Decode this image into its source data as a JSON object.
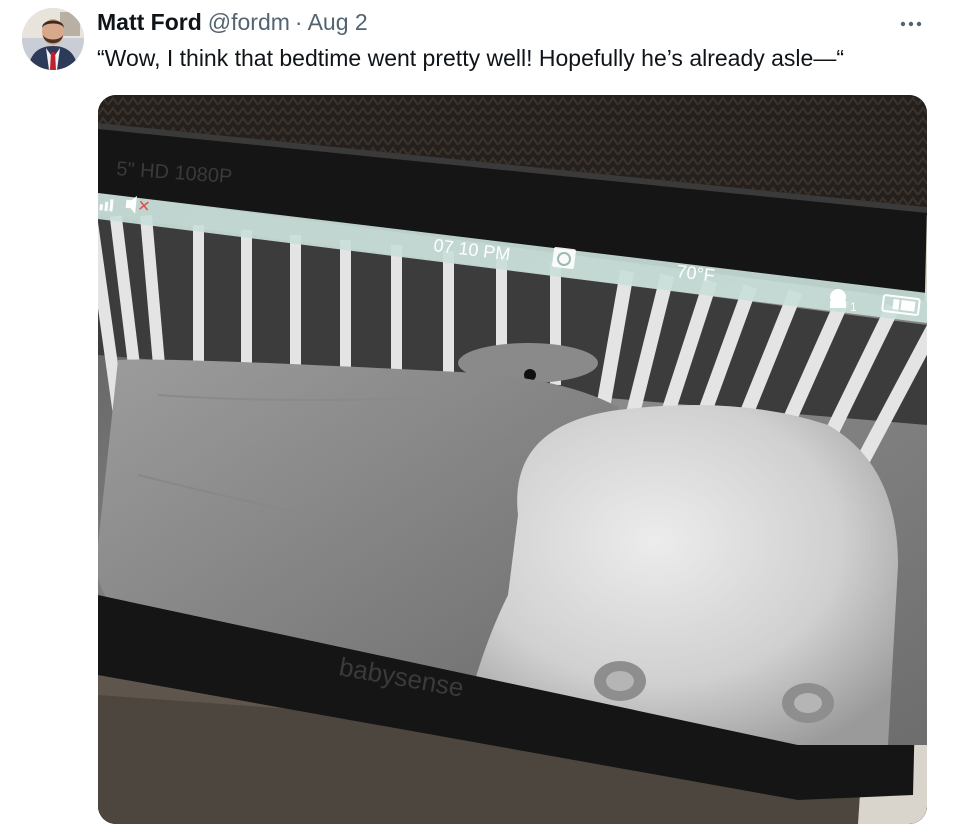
{
  "tweet": {
    "author": {
      "display_name": "Matt Ford",
      "handle": "@fordm",
      "avatar_icon": "user-avatar"
    },
    "separator": "·",
    "date": "Aug 2",
    "more_label": "···",
    "text": "“Wow, I think that bedtime went pretty well! Hopefully he’s already asle—“"
  },
  "monitor": {
    "top_label": "5\" HD 1080P",
    "time": "07 10 PM",
    "temperature": "70°F",
    "camera_number": "1",
    "brand": "babysense",
    "icons": [
      "signal-icon",
      "mute-icon",
      "rotate-icon",
      "camera-icon",
      "battery-icon"
    ]
  },
  "colors": {
    "text_primary": "#0f1419",
    "text_secondary": "#536471",
    "status_bar": "#c9e0d9",
    "status_text": "#ffffff"
  }
}
